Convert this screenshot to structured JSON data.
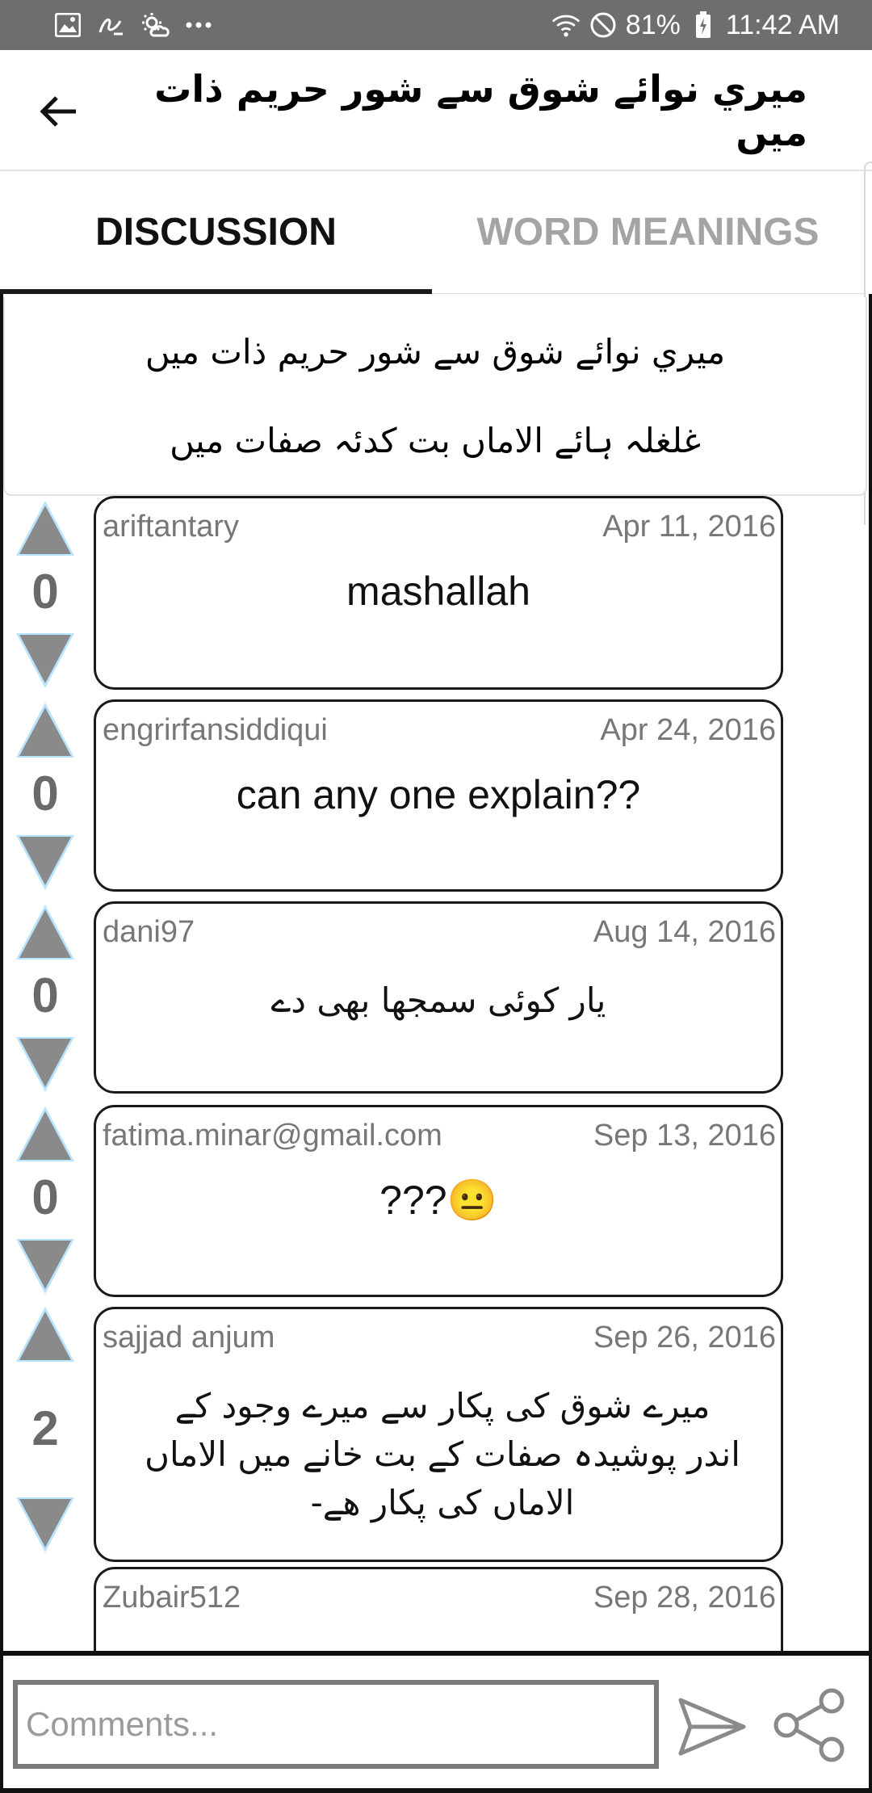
{
  "status_bar": {
    "battery": "81%",
    "time": "11:42 AM",
    "icons_left": [
      "image-icon",
      "cursive-icon",
      "sun-cloud-icon",
      "more-dots-icon"
    ],
    "icons_right": [
      "wifi-icon",
      "do-not-disturb-icon",
      "battery-charging-icon"
    ]
  },
  "app_bar": {
    "title": "ميري نوائے شوق سے شور حريم ذات ميں"
  },
  "tabs": [
    {
      "label": "DISCUSSION",
      "active": true
    },
    {
      "label": "WORD MEANINGS",
      "active": false
    }
  ],
  "verse": {
    "line1": "ميري نوائے شوق سے شور حريم ذات ميں",
    "line2": "غلغلہ ہائے الاماں بت کدئہ صفات ميں"
  },
  "comments": [
    {
      "user": "ariftantary",
      "date": "Apr 11, 2016",
      "text": "mashallah",
      "votes": "0"
    },
    {
      "user": "engrirfansiddiqui",
      "date": "Apr 24, 2016",
      "text": "can any one explain??",
      "votes": "0"
    },
    {
      "user": "dani97",
      "date": "Aug 14, 2016",
      "text": "یار کوئی سمجھا بھی دے",
      "votes": "0"
    },
    {
      "user": "fatima.minar@gmail.com",
      "date": "Sep 13, 2016",
      "text": "???😐",
      "votes": "0"
    },
    {
      "user": "sajjad anjum",
      "date": "Sep 26, 2016",
      "text": "میرے شوق کی پکار سے میرے وجود کے اندر پوشیدہ صفات کے بت خانے میں الاماں الاماں کی پکار ھے-",
      "votes": "2"
    },
    {
      "user": "Zubair512",
      "date": "Sep 28, 2016",
      "text": "",
      "votes": ""
    }
  ],
  "composer": {
    "placeholder": "Comments..."
  },
  "colors": {
    "status_bar_bg": "#6e6e6e",
    "vote_arrow_fill": "#8a8a8a",
    "vote_arrow_glow": "#b8e4ff",
    "active_tab": "#111111",
    "inactive_tab": "#a4a4a4"
  }
}
